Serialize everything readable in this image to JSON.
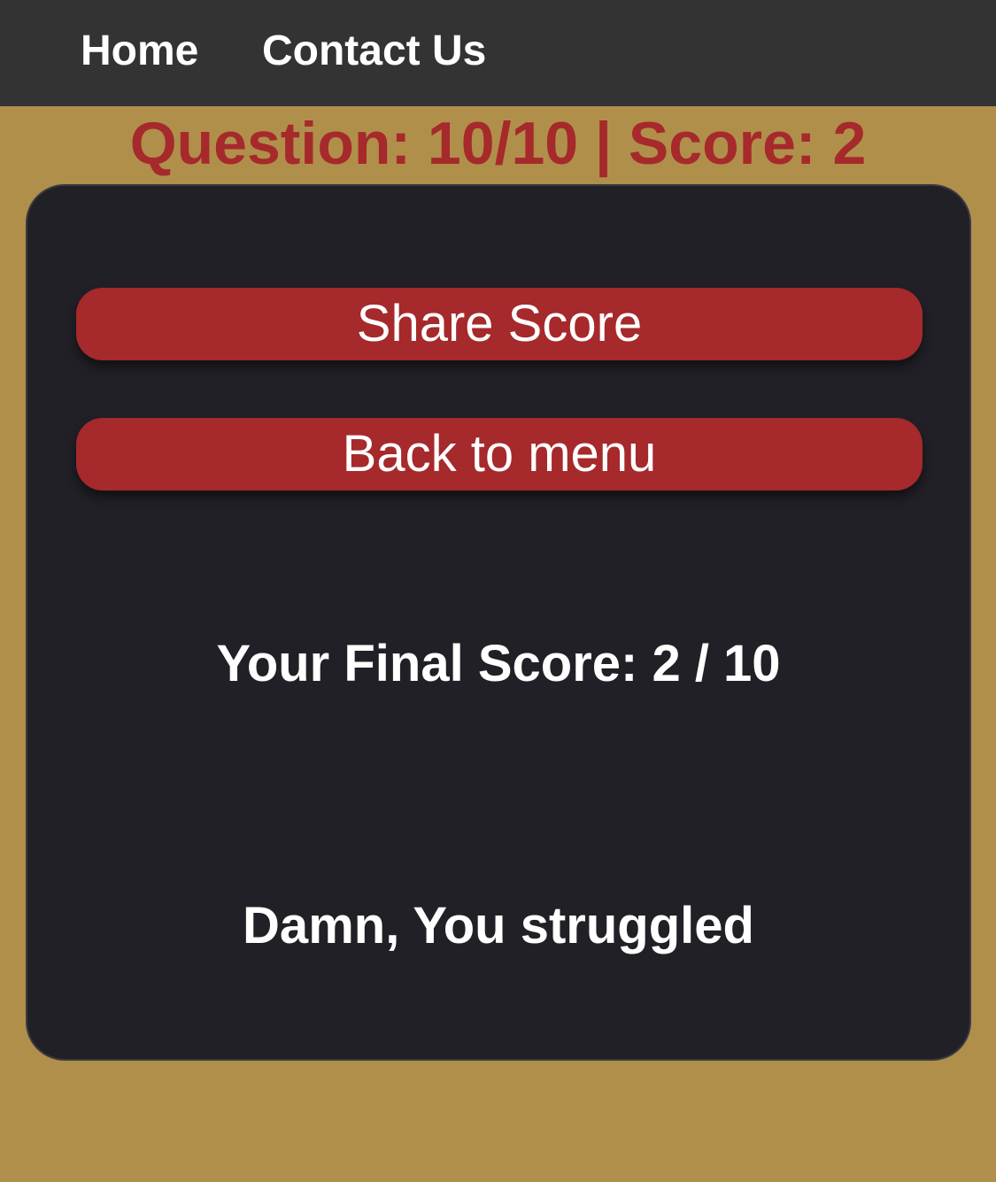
{
  "nav": {
    "home_label": "Home",
    "contact_label": "Contact Us"
  },
  "quiz": {
    "status_text": "Question: 10/10 | Score: 2",
    "share_button_label": "Share Score",
    "back_button_label": "Back to menu",
    "final_score_text": "Your Final Score: 2 / 10",
    "result_message": "Damn, You struggled"
  },
  "colors": {
    "page_background": "#b08f4b",
    "navbar_background": "#333333",
    "card_background": "#202026",
    "accent_red": "#a6292b",
    "text_white": "#ffffff"
  }
}
